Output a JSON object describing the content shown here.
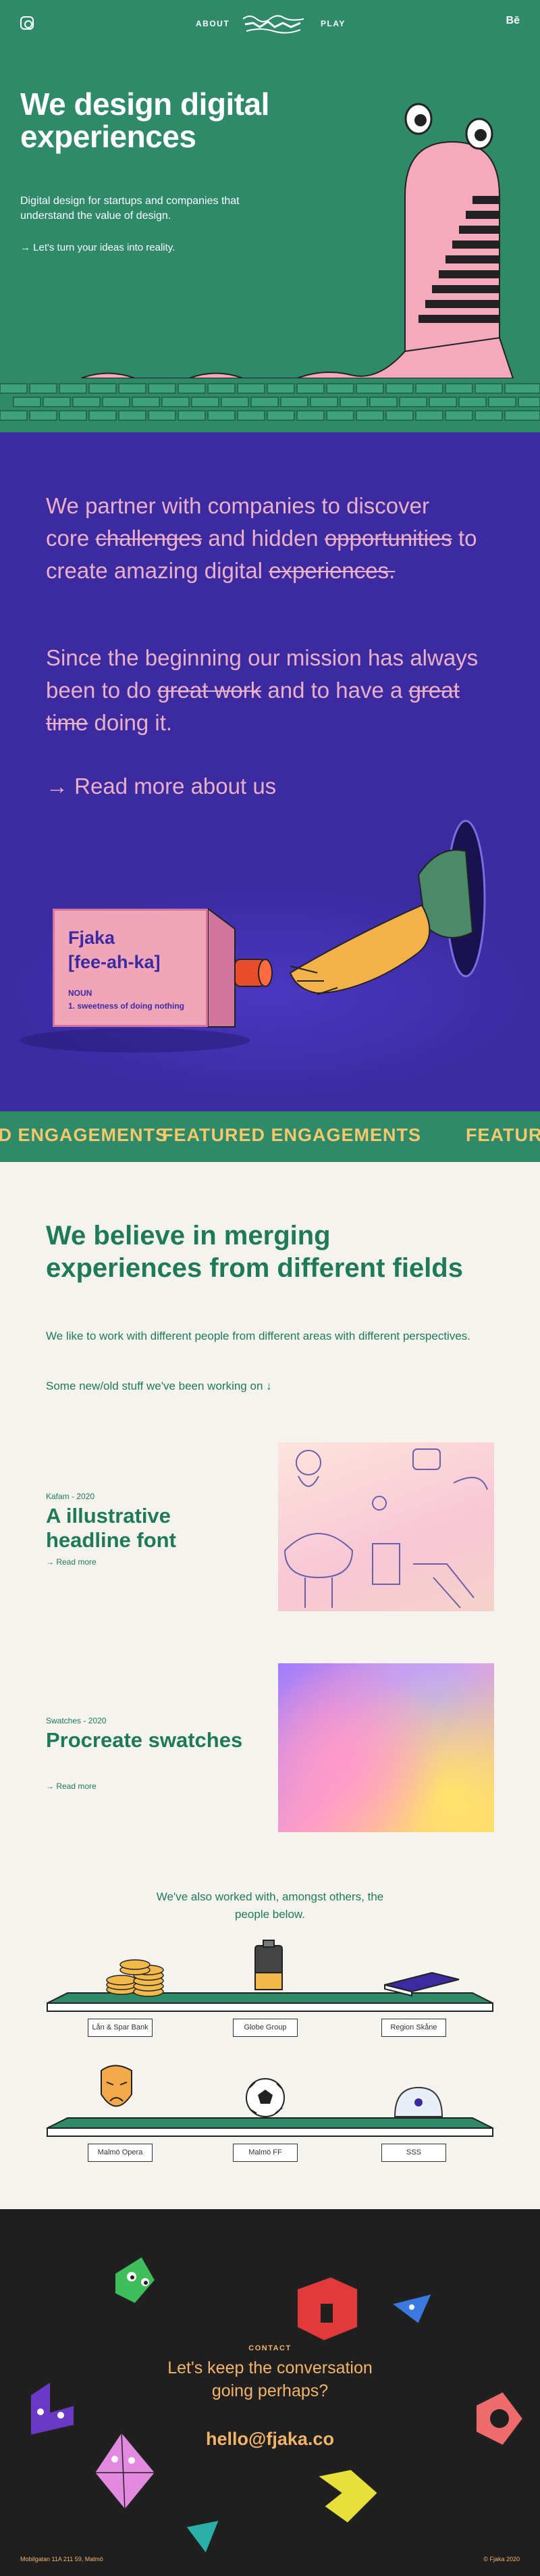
{
  "nav": {
    "about": "ABOUT",
    "play": "PLAY",
    "behance": "Bē"
  },
  "hero": {
    "title": "We design digital experiences",
    "subtitle": "Digital design for startups and companies that understand the value of design.",
    "cta": "Let's turn your ideas into reality."
  },
  "intro": {
    "p1": [
      "We partner with companies to discover core ",
      "challenges",
      " and hidden ",
      "opportunities",
      " to create amazing digital ",
      "experiences."
    ],
    "p2": [
      "Since the beginning our mission has always been to do ",
      "great work",
      " and to have a ",
      "great time",
      " doing it."
    ],
    "read_more": "Read more about us",
    "dictionary": {
      "word": "Fjaka",
      "phonetic": "[fee-ah-ka]",
      "type": "NOUN",
      "definition": "1. sweetness of doing nothing"
    }
  },
  "ticker": {
    "text": "FEATURED ENGAGEMENTS"
  },
  "believe": {
    "title": "We believe in merging experiences from different fields",
    "paragraph": "We like to work with different people from different areas with different perspectives.",
    "link": "Some new/old stuff we've been working on ↓"
  },
  "projects": [
    {
      "meta": "Kafam - 2020",
      "title": "A illustrative headline font",
      "link": "Read more"
    },
    {
      "meta": "Swatches - 2020",
      "title": "Procreate swatches",
      "link": "Read more"
    }
  ],
  "clients": {
    "intro": "We've also worked with, amongst others, the people below.",
    "names": [
      "Lån & Spar Bank",
      "Globe Group",
      "Region Skåne",
      "Malmö Opera",
      "Malmö FF",
      "SSS"
    ]
  },
  "contact": {
    "label": "CONTACT",
    "question": "Let's keep the conversation going perhaps?",
    "email": "hello@fjaka.co",
    "address": "Mobilgatan 11A 211 59, Malmö",
    "copyright": "© Fjaka 2020"
  },
  "colors": {
    "green": "#2e8a68",
    "purple": "#3b2aa0",
    "pink": "#eab0c7",
    "orange": "#f3b46a",
    "dark": "#1f1f1f"
  }
}
